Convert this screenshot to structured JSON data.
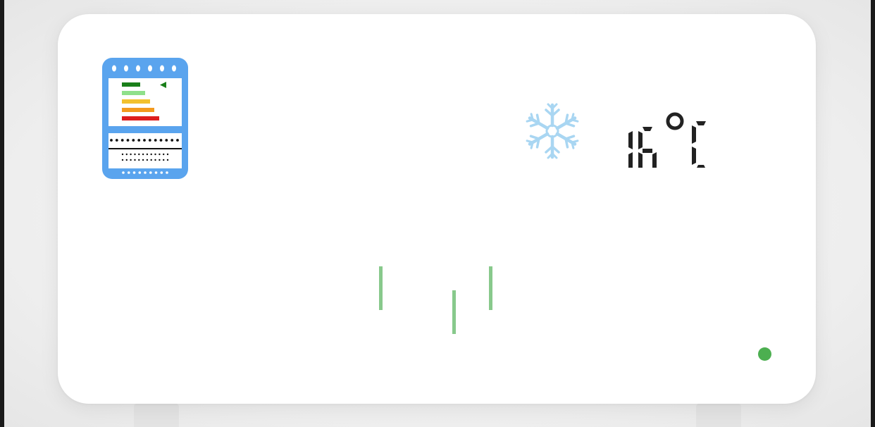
{
  "display": {
    "mode": "cool",
    "temperature": "16",
    "unit": "°C",
    "temperature_text": "16 °C"
  },
  "icons": {
    "energy_label": "energy-rating-label-icon",
    "mode": "snowflake-icon",
    "airflow": "airflow-lines-icon",
    "status": "status-led"
  },
  "colors": {
    "energy_frame": "#5aa4ee",
    "snowflake": "#a9d6f2",
    "lcd_segment": "#222222",
    "airflow": "#88c98c",
    "status_led": "#4caf50",
    "energy_bars": [
      "#1a7f1a",
      "#8fe08a",
      "#f2c12e",
      "#f39a1e",
      "#dd1e1e"
    ]
  }
}
